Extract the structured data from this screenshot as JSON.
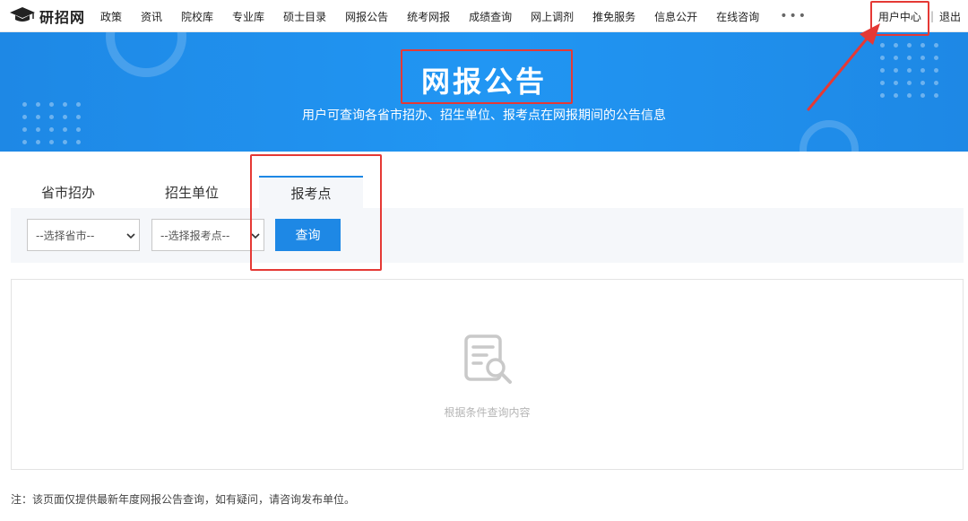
{
  "logo": {
    "text": "研招网",
    "icon": "graduation-cap-icon"
  },
  "nav": {
    "items": [
      "政策",
      "资讯",
      "院校库",
      "专业库",
      "硕士目录",
      "网报公告",
      "统考网报",
      "成绩查询",
      "网上调剂",
      "推免服务",
      "信息公开",
      "在线咨询"
    ],
    "more": "•••",
    "user_center": "用户中心",
    "separator": "|",
    "logout": "退出"
  },
  "banner": {
    "title": "网报公告",
    "subtitle": "用户可查询各省市招办、招生单位、报考点在网报期间的公告信息"
  },
  "tabs": [
    {
      "label": "省市招办",
      "active": false
    },
    {
      "label": "招生单位",
      "active": false
    },
    {
      "label": "报考点",
      "active": true
    }
  ],
  "query": {
    "province_select": "--选择省市--",
    "exam_site_select": "--选择报考点--",
    "button": "查询"
  },
  "result": {
    "empty_icon": "document-search-icon",
    "empty_text": "根据条件查询内容"
  },
  "note": "注：该页面仅提供最新年度网报公告查询，如有疑问，请咨询发布单位。",
  "colors": {
    "primary": "#1e88e5",
    "banner": "#2196f3",
    "highlight": "#e53935",
    "panel_bg": "#f5f7fa"
  }
}
